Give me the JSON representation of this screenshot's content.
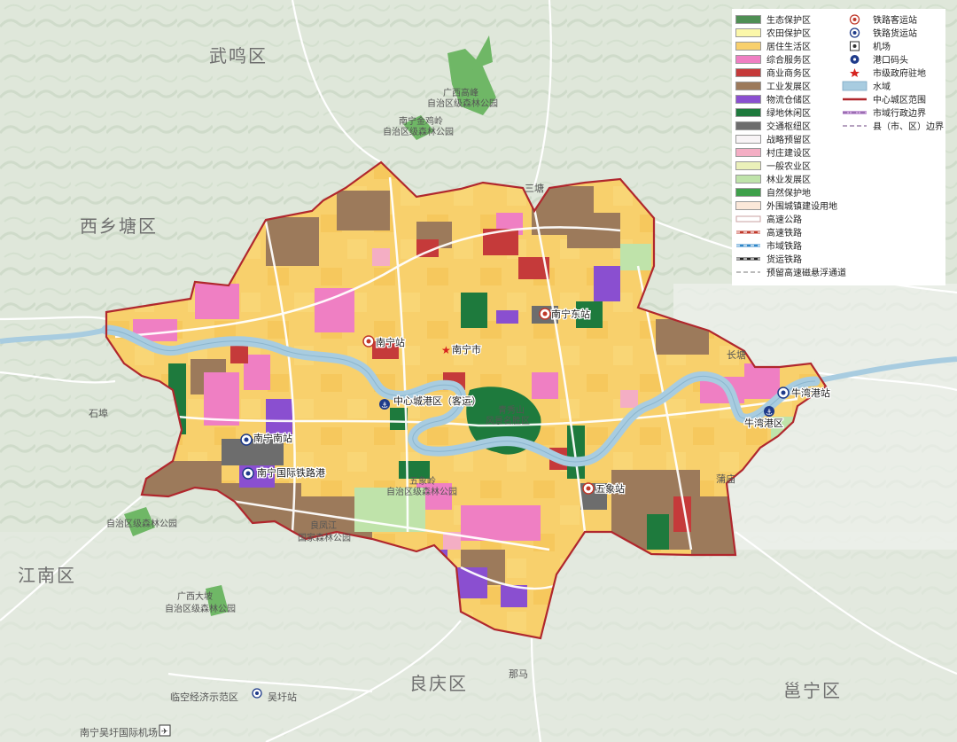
{
  "colors": {
    "background": "#e9ede6",
    "boundary": "#b0272d",
    "river": "#a8cce0",
    "ecological_protection": "#4f8f54",
    "farmland_protection": "#fbf7a9",
    "residential": "#f8d06c",
    "mixed_service": "#ef7fc3",
    "commercial": "#c53a3a",
    "industrial": "#9c7a5b",
    "logistics": "#8a4fd0",
    "green_leisure": "#1e7a3d",
    "transport_hub": "#6d6d6d",
    "strategic_reserve": "#f8f4f6",
    "village": "#f4aec4",
    "general_agriculture": "#eaf0b9",
    "forestry": "#bfe3aa",
    "nature_reserve": "#3ea04a",
    "outer_urban": "#fbe8d9"
  },
  "districts": [
    {
      "label": "武鸣区"
    },
    {
      "label": "西乡塘区"
    },
    {
      "label": "江南区"
    },
    {
      "label": "良庆区"
    },
    {
      "label": "邕宁区"
    }
  ],
  "places": {
    "sanтang": "三塘",
    "shibu": "石埠",
    "changtang": "长塘",
    "pupo": "蒲庙",
    "nama": "那马",
    "linkong": "临空经济示范区",
    "wuxu_station": "吴圩站",
    "airport": "南宁吴圩国际机场",
    "park_daming_1": "广西高峰",
    "park_daming_2": "自治区级森林公园",
    "park_nanning_1": "南宁金鸡岭",
    "park_nanning_2": "自治区级森林公园",
    "park_sw_1": "自治区级森林公园",
    "park_liangfeng_1": "良凤江",
    "park_liangfeng_2": "国家森林公园",
    "park_guangwo_1": "广西大坡",
    "park_guangwo_2": "自治区级森林公园",
    "park_wuxiang_1": "五象岭",
    "park_wuxiang_2": "自治区级森林公园",
    "scenic_1": "青秀山",
    "scenic_2": "风景名胜区"
  },
  "stations": [
    {
      "label": "南宁东站",
      "type": "rail"
    },
    {
      "label": "南宁站",
      "type": "rail"
    },
    {
      "label": "南宁市",
      "type": "gov"
    },
    {
      "label": "中心城港区（客运）",
      "type": "port"
    },
    {
      "label": "南宁南站",
      "type": "freight"
    },
    {
      "label": "南宁国际铁路港",
      "type": "freight"
    },
    {
      "label": "五象站",
      "type": "rail"
    },
    {
      "label": "牛湾港站",
      "type": "freight"
    },
    {
      "label": "牛湾港区",
      "type": "port"
    }
  ],
  "legend": {
    "col1": [
      {
        "label": "生态保护区",
        "color": "#4f8f54"
      },
      {
        "label": "农田保护区",
        "color": "#fbf7a9"
      },
      {
        "label": "居住生活区",
        "color": "#f8d06c"
      },
      {
        "label": "综合服务区",
        "color": "#ef7fc3"
      },
      {
        "label": "商业商务区",
        "color": "#c53a3a"
      },
      {
        "label": "工业发展区",
        "color": "#9c7a5b"
      },
      {
        "label": "物流仓储区",
        "color": "#8a4fd0"
      },
      {
        "label": "绿地休闲区",
        "color": "#1e7a3d"
      },
      {
        "label": "交通枢纽区",
        "color": "#6d6d6d"
      },
      {
        "label": "战略预留区",
        "color": "#f8f4f6"
      },
      {
        "label": "村庄建设区",
        "color": "#f4aec4"
      },
      {
        "label": "一般农业区",
        "color": "#eaf0b9"
      },
      {
        "label": "林业发展区",
        "color": "#bfe3aa"
      },
      {
        "label": "自然保护地",
        "color": "#3ea04a"
      },
      {
        "label": "外围城镇建设用地",
        "color": "#fbe8d9"
      },
      {
        "label": "高速公路",
        "icon": "expressway-line-icon"
      },
      {
        "label": "高速铁路",
        "icon": "high-speed-rail-line-icon"
      },
      {
        "label": "市域铁路",
        "icon": "city-rail-line-icon"
      },
      {
        "label": "货运铁路",
        "icon": "freight-rail-line-icon"
      },
      {
        "label": "预留高速磁悬浮通道",
        "icon": "maglev-line-icon"
      }
    ],
    "col2": [
      {
        "label": "铁路客运站",
        "icon": "passenger-station-icon"
      },
      {
        "label": "铁路货运站",
        "icon": "freight-station-icon"
      },
      {
        "label": "机场",
        "icon": "airport-icon"
      },
      {
        "label": "港口码头",
        "icon": "port-icon"
      },
      {
        "label": "市级政府驻地",
        "icon": "government-star-icon"
      },
      {
        "label": "水域",
        "icon": "water-swatch-icon"
      },
      {
        "label": "中心城区范围",
        "icon": "central-boundary-line-icon"
      },
      {
        "label": "市域行政边界",
        "icon": "city-admin-boundary-icon"
      },
      {
        "label": "县（市、区）边界",
        "icon": "county-boundary-line-icon"
      }
    ]
  }
}
